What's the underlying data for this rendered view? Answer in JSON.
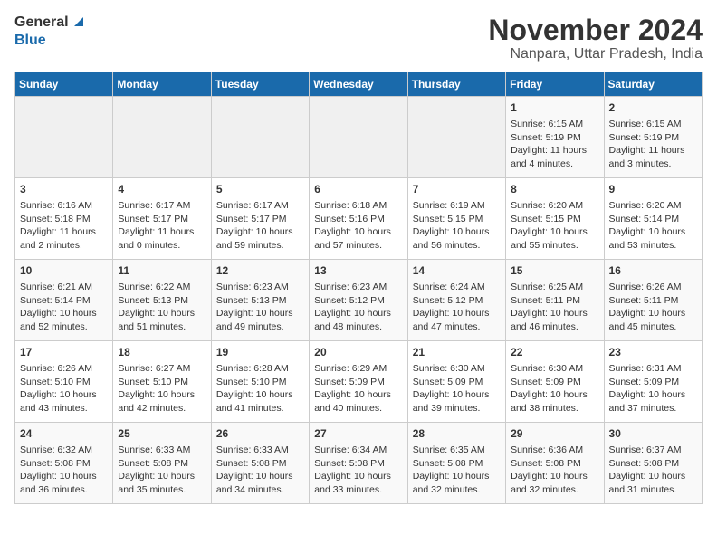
{
  "header": {
    "logo_general": "General",
    "logo_blue": "Blue",
    "title": "November 2024",
    "subtitle": "Nanpara, Uttar Pradesh, India"
  },
  "calendar": {
    "days_of_week": [
      "Sunday",
      "Monday",
      "Tuesday",
      "Wednesday",
      "Thursday",
      "Friday",
      "Saturday"
    ],
    "weeks": [
      [
        {
          "day": "",
          "content": ""
        },
        {
          "day": "",
          "content": ""
        },
        {
          "day": "",
          "content": ""
        },
        {
          "day": "",
          "content": ""
        },
        {
          "day": "",
          "content": ""
        },
        {
          "day": "1",
          "content": "Sunrise: 6:15 AM\nSunset: 5:19 PM\nDaylight: 11 hours and 4 minutes."
        },
        {
          "day": "2",
          "content": "Sunrise: 6:15 AM\nSunset: 5:19 PM\nDaylight: 11 hours and 3 minutes."
        }
      ],
      [
        {
          "day": "3",
          "content": "Sunrise: 6:16 AM\nSunset: 5:18 PM\nDaylight: 11 hours and 2 minutes."
        },
        {
          "day": "4",
          "content": "Sunrise: 6:17 AM\nSunset: 5:17 PM\nDaylight: 11 hours and 0 minutes."
        },
        {
          "day": "5",
          "content": "Sunrise: 6:17 AM\nSunset: 5:17 PM\nDaylight: 10 hours and 59 minutes."
        },
        {
          "day": "6",
          "content": "Sunrise: 6:18 AM\nSunset: 5:16 PM\nDaylight: 10 hours and 57 minutes."
        },
        {
          "day": "7",
          "content": "Sunrise: 6:19 AM\nSunset: 5:15 PM\nDaylight: 10 hours and 56 minutes."
        },
        {
          "day": "8",
          "content": "Sunrise: 6:20 AM\nSunset: 5:15 PM\nDaylight: 10 hours and 55 minutes."
        },
        {
          "day": "9",
          "content": "Sunrise: 6:20 AM\nSunset: 5:14 PM\nDaylight: 10 hours and 53 minutes."
        }
      ],
      [
        {
          "day": "10",
          "content": "Sunrise: 6:21 AM\nSunset: 5:14 PM\nDaylight: 10 hours and 52 minutes."
        },
        {
          "day": "11",
          "content": "Sunrise: 6:22 AM\nSunset: 5:13 PM\nDaylight: 10 hours and 51 minutes."
        },
        {
          "day": "12",
          "content": "Sunrise: 6:23 AM\nSunset: 5:13 PM\nDaylight: 10 hours and 49 minutes."
        },
        {
          "day": "13",
          "content": "Sunrise: 6:23 AM\nSunset: 5:12 PM\nDaylight: 10 hours and 48 minutes."
        },
        {
          "day": "14",
          "content": "Sunrise: 6:24 AM\nSunset: 5:12 PM\nDaylight: 10 hours and 47 minutes."
        },
        {
          "day": "15",
          "content": "Sunrise: 6:25 AM\nSunset: 5:11 PM\nDaylight: 10 hours and 46 minutes."
        },
        {
          "day": "16",
          "content": "Sunrise: 6:26 AM\nSunset: 5:11 PM\nDaylight: 10 hours and 45 minutes."
        }
      ],
      [
        {
          "day": "17",
          "content": "Sunrise: 6:26 AM\nSunset: 5:10 PM\nDaylight: 10 hours and 43 minutes."
        },
        {
          "day": "18",
          "content": "Sunrise: 6:27 AM\nSunset: 5:10 PM\nDaylight: 10 hours and 42 minutes."
        },
        {
          "day": "19",
          "content": "Sunrise: 6:28 AM\nSunset: 5:10 PM\nDaylight: 10 hours and 41 minutes."
        },
        {
          "day": "20",
          "content": "Sunrise: 6:29 AM\nSunset: 5:09 PM\nDaylight: 10 hours and 40 minutes."
        },
        {
          "day": "21",
          "content": "Sunrise: 6:30 AM\nSunset: 5:09 PM\nDaylight: 10 hours and 39 minutes."
        },
        {
          "day": "22",
          "content": "Sunrise: 6:30 AM\nSunset: 5:09 PM\nDaylight: 10 hours and 38 minutes."
        },
        {
          "day": "23",
          "content": "Sunrise: 6:31 AM\nSunset: 5:09 PM\nDaylight: 10 hours and 37 minutes."
        }
      ],
      [
        {
          "day": "24",
          "content": "Sunrise: 6:32 AM\nSunset: 5:08 PM\nDaylight: 10 hours and 36 minutes."
        },
        {
          "day": "25",
          "content": "Sunrise: 6:33 AM\nSunset: 5:08 PM\nDaylight: 10 hours and 35 minutes."
        },
        {
          "day": "26",
          "content": "Sunrise: 6:33 AM\nSunset: 5:08 PM\nDaylight: 10 hours and 34 minutes."
        },
        {
          "day": "27",
          "content": "Sunrise: 6:34 AM\nSunset: 5:08 PM\nDaylight: 10 hours and 33 minutes."
        },
        {
          "day": "28",
          "content": "Sunrise: 6:35 AM\nSunset: 5:08 PM\nDaylight: 10 hours and 32 minutes."
        },
        {
          "day": "29",
          "content": "Sunrise: 6:36 AM\nSunset: 5:08 PM\nDaylight: 10 hours and 32 minutes."
        },
        {
          "day": "30",
          "content": "Sunrise: 6:37 AM\nSunset: 5:08 PM\nDaylight: 10 hours and 31 minutes."
        }
      ]
    ]
  }
}
